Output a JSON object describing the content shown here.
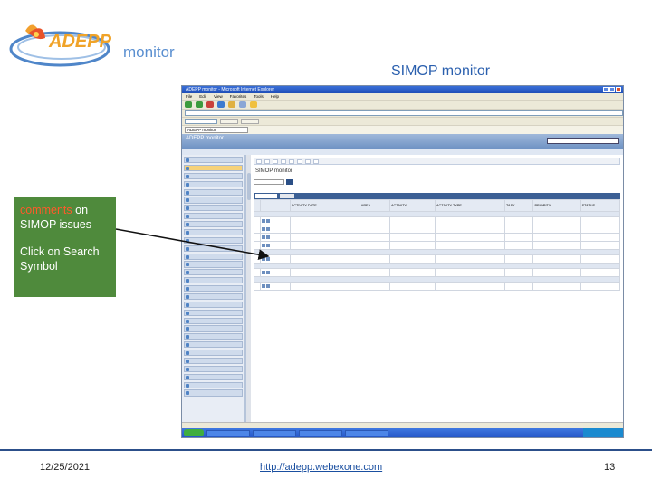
{
  "header": {
    "logo_text": "ADEPP",
    "logo_suffix": "monitor",
    "slide_title": "SIMOP monitor"
  },
  "callout": {
    "line1_highlight": "comments",
    "line1_rest": " on SIMOP issues",
    "line2": "Click on Search Symbol"
  },
  "browser": {
    "title": "ADEPP monitor - Microsoft Internet Explorer",
    "menu": [
      "File",
      "Edit",
      "View",
      "Favorites",
      "Tools",
      "Help"
    ],
    "tab_label": "ADEPP monitor",
    "app_header": "ADEPP monitor",
    "page_heading": "SIMOP monitor",
    "columns": [
      "",
      "",
      "ACTIVITY DATE",
      "AREA",
      "ACTIVITY",
      "ACTIVITY TYPE",
      "TASK",
      "PRIORITY",
      "STATUS"
    ]
  },
  "footer": {
    "date": "12/25/2021",
    "url": "http://adepp.webexone.com",
    "page_number": "13"
  },
  "colors": {
    "accent": "#2a5fae",
    "panel": "#4f8a3c",
    "highlight": "#ff5a2a"
  }
}
